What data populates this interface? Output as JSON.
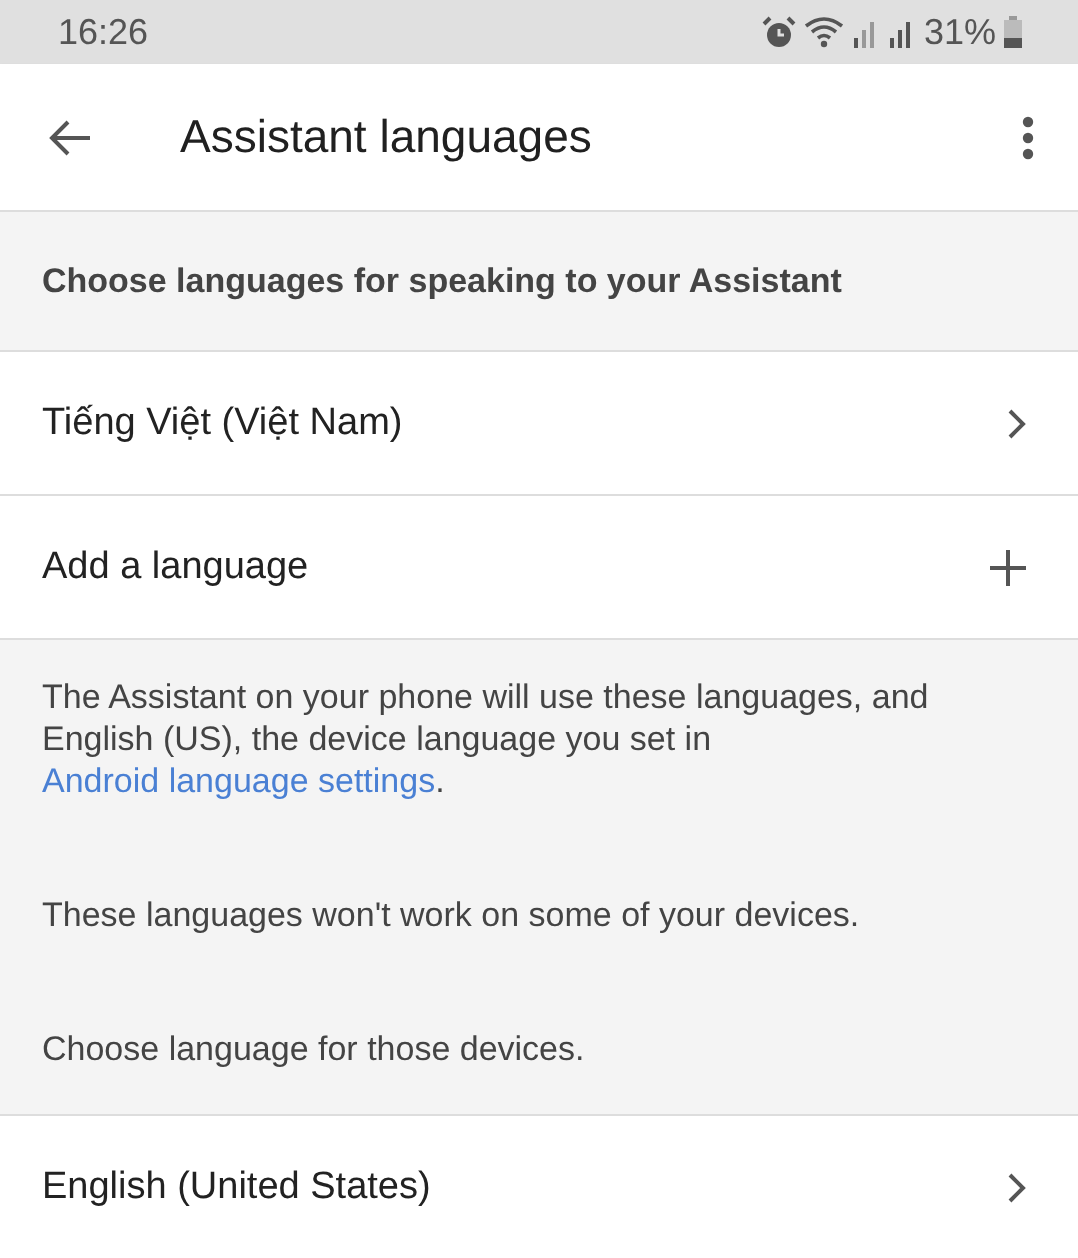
{
  "status_bar": {
    "time": "16:26",
    "battery": "31%"
  },
  "app_bar": {
    "title": "Assistant languages"
  },
  "section_header": "Choose languages for speaking to your Assistant",
  "languages": [
    {
      "kind": "language",
      "label": "Tiếng Việt (Việt Nam)"
    },
    {
      "kind": "add",
      "label": "Add a language"
    }
  ],
  "info": {
    "text_before": "The Assistant on your phone will use these languages, and English (US), the device language you set in ",
    "link": "Android language settings",
    "text_after": ".",
    "notes": [
      "These languages won't work on some of your devices.",
      "Choose language for those devices."
    ]
  },
  "devices_languages": [
    {
      "kind": "language",
      "label": "English (United States)"
    }
  ]
}
